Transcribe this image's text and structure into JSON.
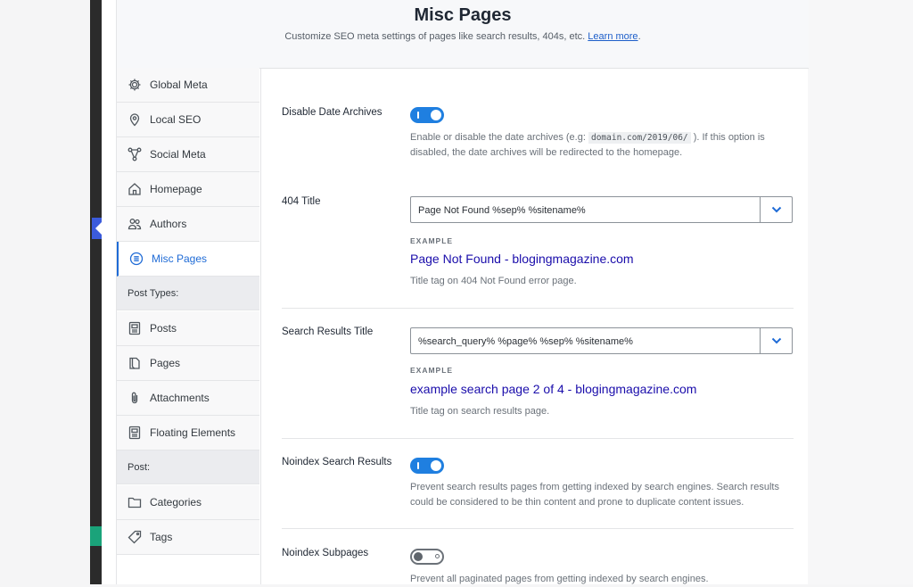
{
  "header": {
    "title": "Misc Pages",
    "subtitle": "Customize SEO meta settings of pages like search results, 404s, etc.",
    "learn_more": "Learn more",
    "period": "."
  },
  "sidebar": {
    "items": [
      {
        "label": "Global Meta",
        "icon": "gear-icon"
      },
      {
        "label": "Local SEO",
        "icon": "location-pin-icon"
      },
      {
        "label": "Social Meta",
        "icon": "share-nodes-icon"
      },
      {
        "label": "Homepage",
        "icon": "home-icon"
      },
      {
        "label": "Authors",
        "icon": "users-icon"
      },
      {
        "label": "Misc Pages",
        "icon": "list-circle-icon",
        "active": true
      }
    ],
    "post_types_heading": "Post Types:",
    "post_types": [
      {
        "label": "Posts",
        "icon": "document-icon"
      },
      {
        "label": "Pages",
        "icon": "page-icon"
      },
      {
        "label": "Attachments",
        "icon": "paperclip-icon"
      },
      {
        "label": "Floating Elements",
        "icon": "document-icon"
      }
    ],
    "post_heading": "Post:",
    "post": [
      {
        "label": "Categories",
        "icon": "folder-icon"
      },
      {
        "label": "Tags",
        "icon": "tag-icon"
      }
    ]
  },
  "settings": {
    "date_archives": {
      "label": "Disable Date Archives",
      "enabled": true,
      "desc_before": "Enable or disable the date archives (e.g: ",
      "desc_code": "domain.com/2019/06/",
      "desc_after": " ). If this option is disabled, the date archives will be redirected to the homepage."
    },
    "title_404": {
      "label": "404 Title",
      "value": "Page Not Found %sep% %sitename%",
      "example_label": "EXAMPLE",
      "example": "Page Not Found - blogingmagazine.com",
      "help": "Title tag on 404 Not Found error page."
    },
    "search_title": {
      "label": "Search Results Title",
      "value": "%search_query% %page% %sep% %sitename%",
      "example_label": "EXAMPLE",
      "example": "example search page 2 of 4 - blogingmagazine.com",
      "help": "Title tag on search results page."
    },
    "noindex_search": {
      "label": "Noindex Search Results",
      "enabled": true,
      "desc": "Prevent search results pages from getting indexed by search engines. Search results could be considered to be thin content and prone to duplicate content issues."
    },
    "noindex_subpages": {
      "label": "Noindex Subpages",
      "enabled": false,
      "desc": "Prevent all paginated pages from getting indexed by search engines."
    }
  },
  "colors": {
    "accent": "#1f7fe0",
    "example_link": "#1a0dab",
    "active_nav": "#1f6bd6"
  }
}
